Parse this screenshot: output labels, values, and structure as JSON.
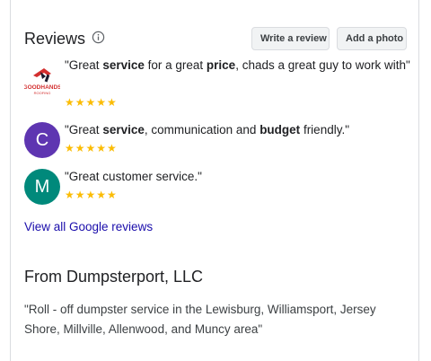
{
  "reviews_section": {
    "title": "Reviews",
    "info_icon": "info-icon",
    "write_review_label": "Write a review",
    "add_photo_label": "Add a photo",
    "view_all_label": "View all Google reviews"
  },
  "reviews": [
    {
      "avatar_type": "logo",
      "logo_text": "GOODHANDS",
      "logo_subtext": "ROOFING",
      "parts": [
        "\"Great ",
        "service",
        " for a great ",
        "price",
        ", chads a great guy to work with\""
      ],
      "rating": 5,
      "stars": "★★★★★"
    },
    {
      "avatar_type": "letter",
      "letter": "C",
      "color": "#5e35b1",
      "parts": [
        "\"Great ",
        "service",
        ", communication and ",
        "budget",
        " friendly.\""
      ],
      "rating": 5,
      "stars": "★★★★★"
    },
    {
      "avatar_type": "letter",
      "letter": "M",
      "color": "#00897b",
      "parts": [
        "\"Great customer service.\""
      ],
      "rating": 5,
      "stars": "★★★★★"
    }
  ],
  "from_section": {
    "title": "From Dumpsterport, LLC",
    "description": "\"Roll - off dumpster service in the Lewisburg, Williamsport, Jersey Shore, Millville, Allenwood, and Muncy area\""
  },
  "colors": {
    "star": "#fbbc04",
    "link": "#1a0dab",
    "avatar_c": "#5e35b1",
    "avatar_m": "#00897b",
    "logo_red": "#d32f2f"
  }
}
